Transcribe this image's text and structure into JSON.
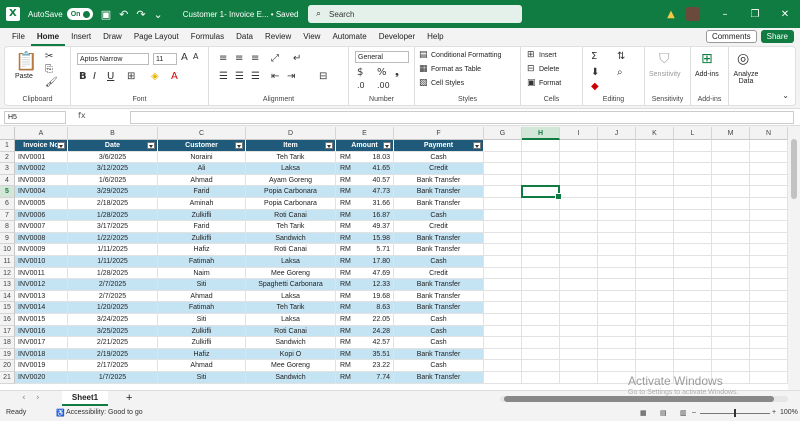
{
  "titlebar": {
    "autosave_label": "AutoSave",
    "autosave_state": "On",
    "doc_title": "Customer 1- Invoice E... • Saved",
    "search_placeholder": "Search"
  },
  "menu": {
    "tabs": [
      "File",
      "Home",
      "Insert",
      "Draw",
      "Page Layout",
      "Formulas",
      "Data",
      "Review",
      "View",
      "Automate",
      "Developer",
      "Help"
    ],
    "active": "Home",
    "comments_label": "Comments",
    "share_label": "Share"
  },
  "ribbon": {
    "clipboard": {
      "paste": "Paste",
      "label": "Clipboard"
    },
    "font": {
      "name": "Aptos Narrow",
      "size": "11",
      "label": "Font"
    },
    "alignment": {
      "label": "Alignment"
    },
    "number": {
      "format": "General",
      "label": "Number"
    },
    "styles": {
      "conditional": "Conditional Formatting",
      "format_table": "Format as Table",
      "cell_styles": "Cell Styles",
      "label": "Styles"
    },
    "cells": {
      "insert": "Insert",
      "delete": "Delete",
      "format": "Format",
      "label": "Cells"
    },
    "editing": {
      "label": "Editing"
    },
    "sensitivity": {
      "label": "Sensitivity",
      "group": "Sensitivity"
    },
    "addins": {
      "label": "Add-ins",
      "group": "Add-ins"
    },
    "analyze": {
      "label": "Analyze Data"
    }
  },
  "formula_bar": {
    "name_box": "H5",
    "fx": "fx",
    "value": ""
  },
  "columns": [
    "A",
    "B",
    "C",
    "D",
    "E",
    "F",
    "G",
    "H",
    "I",
    "J",
    "K",
    "L",
    "M",
    "N"
  ],
  "selected_column": "H",
  "selected_cell": "H5",
  "table": {
    "headers": [
      "Invoice No",
      "Date",
      "Customer",
      "Item",
      "Amount",
      "Payment"
    ],
    "currency": "RM",
    "rows": [
      [
        "INV0001",
        "3/6/2025",
        "Noraini",
        "Teh Tarik",
        "18.03",
        "Cash"
      ],
      [
        "INV0002",
        "3/12/2025",
        "Ali",
        "Laksa",
        "41.65",
        "Credit"
      ],
      [
        "INV0003",
        "1/6/2025",
        "Ahmad",
        "Ayam Goreng",
        "40.57",
        "Bank Transfer"
      ],
      [
        "INV0004",
        "3/29/2025",
        "Farid",
        "Popia Carbonara",
        "47.73",
        "Bank Transfer"
      ],
      [
        "INV0005",
        "2/18/2025",
        "Aminah",
        "Popia Carbonara",
        "31.66",
        "Bank Transfer"
      ],
      [
        "INV0006",
        "1/28/2025",
        "Zulkifli",
        "Roti Canai",
        "16.87",
        "Cash"
      ],
      [
        "INV0007",
        "3/17/2025",
        "Farid",
        "Teh Tarik",
        "49.37",
        "Credit"
      ],
      [
        "INV0008",
        "1/22/2025",
        "Zulkifli",
        "Sandwich",
        "15.98",
        "Bank Transfer"
      ],
      [
        "INV0009",
        "1/11/2025",
        "Hafiz",
        "Roti Canai",
        "5.71",
        "Bank Transfer"
      ],
      [
        "INV0010",
        "1/11/2025",
        "Fatimah",
        "Laksa",
        "17.80",
        "Cash"
      ],
      [
        "INV0011",
        "1/28/2025",
        "Naim",
        "Mee Goreng",
        "47.69",
        "Credit"
      ],
      [
        "INV0012",
        "2/7/2025",
        "Siti",
        "Spaghetti Carbonara",
        "12.33",
        "Bank Transfer"
      ],
      [
        "INV0013",
        "2/7/2025",
        "Ahmad",
        "Laksa",
        "19.68",
        "Bank Transfer"
      ],
      [
        "INV0014",
        "1/20/2025",
        "Fatimah",
        "Teh Tarik",
        "8.63",
        "Bank Transfer"
      ],
      [
        "INV0015",
        "3/24/2025",
        "Siti",
        "Laksa",
        "22.05",
        "Cash"
      ],
      [
        "INV0016",
        "3/25/2025",
        "Zulkifli",
        "Roti Canai",
        "24.28",
        "Cash"
      ],
      [
        "INV0017",
        "2/21/2025",
        "Zulkifli",
        "Sandwich",
        "42.57",
        "Cash"
      ],
      [
        "INV0018",
        "2/19/2025",
        "Hafiz",
        "Kopi O",
        "35.51",
        "Bank Transfer"
      ],
      [
        "INV0019",
        "2/17/2025",
        "Ahmad",
        "Mee Goreng",
        "23.22",
        "Cash"
      ],
      [
        "INV0020",
        "1/7/2025",
        "Siti",
        "Sandwich",
        "7.74",
        "Bank Transfer"
      ]
    ]
  },
  "sheets": {
    "active": "Sheet1",
    "add": "+"
  },
  "status": {
    "ready": "Ready",
    "accessibility": "Accessibility: Good to go",
    "zoom": "100%"
  },
  "watermark": {
    "line1": "Activate Windows",
    "line2": "Go to Settings to activate Windows."
  },
  "colors": {
    "excel_green": "#107c41",
    "header_fill": "#1f5a7a",
    "band_fill": "#c5e4f3"
  }
}
